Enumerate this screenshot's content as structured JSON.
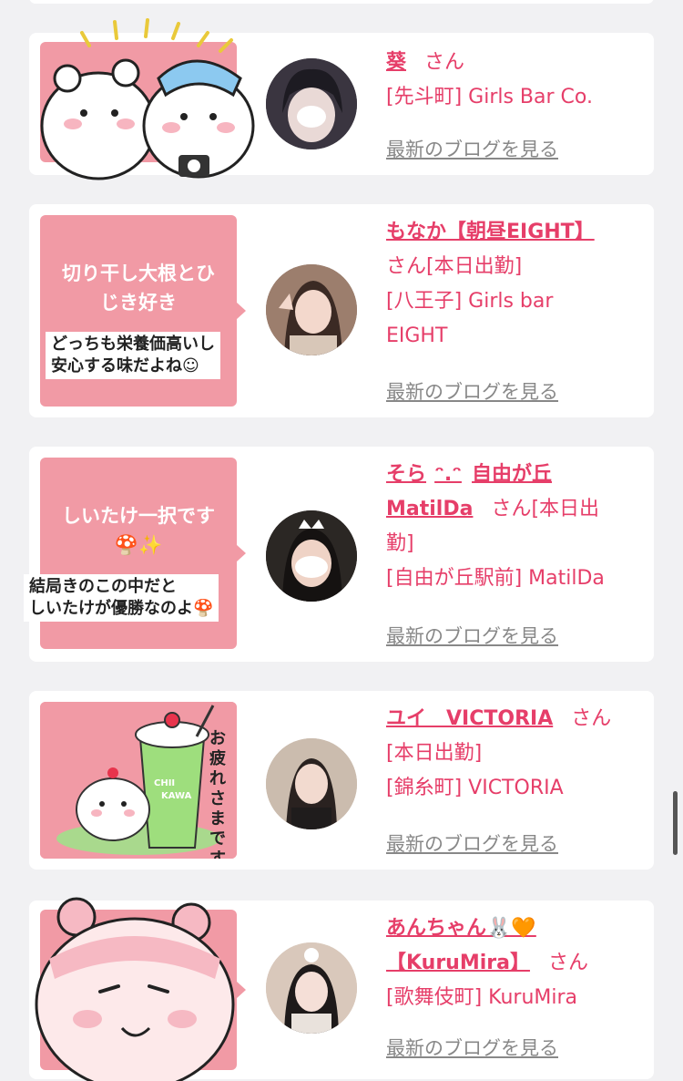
{
  "colors": {
    "accent": "#e63e69",
    "thumb_pink": "#f19aa5",
    "link_gray": "#888888"
  },
  "cards": [
    {
      "name": "葵",
      "san": "さん",
      "meta_lines": [
        "[先斗町] Girls Bar Co."
      ],
      "blog_link": "最新のブログを見る",
      "thumb_big": "",
      "thumb_sub": ""
    },
    {
      "name": "もなか【朝昼EIGHT】",
      "san": "さん[本日出勤]",
      "meta_lines": [
        "[八王子] Girls bar",
        "EIGHT"
      ],
      "blog_link": "最新のブログを見る",
      "thumb_big": "切り干し大根とひ\nじき好き",
      "thumb_sub": "どっちも栄養価高いし\n安心する味だよね☺"
    },
    {
      "name": "そら",
      "name2": "自由が丘",
      "name3": "MatilDa",
      "san": "さん[本日出",
      "meta_lines": [
        "勤]",
        "[自由が丘駅前] MatilDa"
      ],
      "blog_link": "最新のブログを見る",
      "thumb_big": "しいたけ一択です\n🍄✨",
      "thumb_sub": "結局きのこの中だと\nしいたけが優勝なのよ🍄"
    },
    {
      "name": "ユイ　VICTORIA",
      "san": "さん",
      "meta_lines": [
        "[本日出勤]",
        "[錦糸町] VICTORIA"
      ],
      "blog_link": "最新のブログを見る",
      "thumb_big": "",
      "thumb_sub": "",
      "sticker_text": [
        "CHII",
        "KAWA",
        "お疲れさまです"
      ]
    },
    {
      "name": "あんちゃん🐰🧡",
      "name2": "【KuruMira】",
      "san": "さん",
      "meta_lines": [
        "[歌舞伎町] KuruMira"
      ],
      "blog_link": "最新のブログを見る",
      "thumb_big": "",
      "thumb_sub": ""
    }
  ]
}
